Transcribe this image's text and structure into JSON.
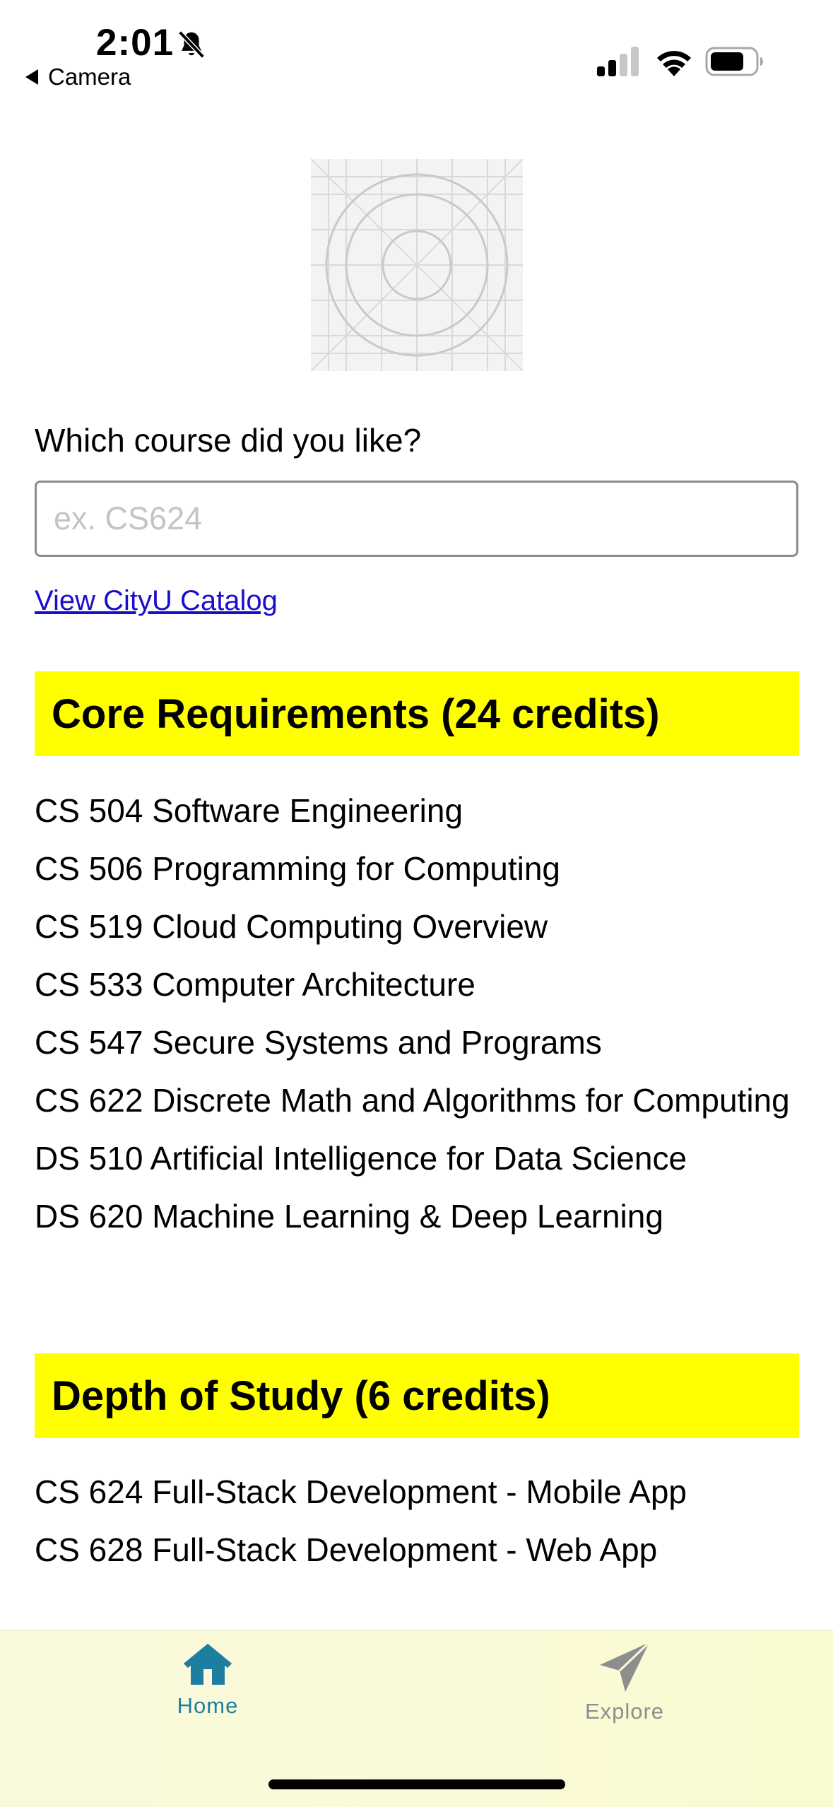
{
  "status_bar": {
    "time": "2:01",
    "back_label": "Camera",
    "icons": [
      "bell-slash-icon",
      "cellular-signal-icon",
      "wifi-icon",
      "battery-icon"
    ]
  },
  "form": {
    "question": "Which course did you like?",
    "input_placeholder": "ex. CS624",
    "input_value": "",
    "catalog_link": "View CityU Catalog"
  },
  "sections": [
    {
      "title": "Core Requirements (24 credits)",
      "courses": [
        "CS 504 Software Engineering",
        "CS 506 Programming for Computing",
        "CS 519 Cloud Computing Overview",
        "CS 533 Computer Architecture",
        "CS 547 Secure Systems and Programs",
        "CS 622 Discrete Math and Algorithms for Computing",
        "DS 510 Artificial Intelligence for Data Science",
        "DS 620 Machine Learning & Deep Learning"
      ]
    },
    {
      "title": "Depth of Study (6 credits)",
      "courses": [
        "CS 624 Full-Stack Development - Mobile App",
        "CS 628 Full-Stack Development - Web App"
      ]
    }
  ],
  "tab_bar": {
    "tabs": [
      {
        "label": "Home",
        "icon": "home-icon",
        "active": true
      },
      {
        "label": "Explore",
        "icon": "paper-plane-icon",
        "active": false
      }
    ]
  },
  "colors": {
    "section_header_bg": "#ffff00",
    "link": "#1a0dcc",
    "tab_active": "#1c7fa0",
    "tab_inactive": "#8e8e8e"
  }
}
